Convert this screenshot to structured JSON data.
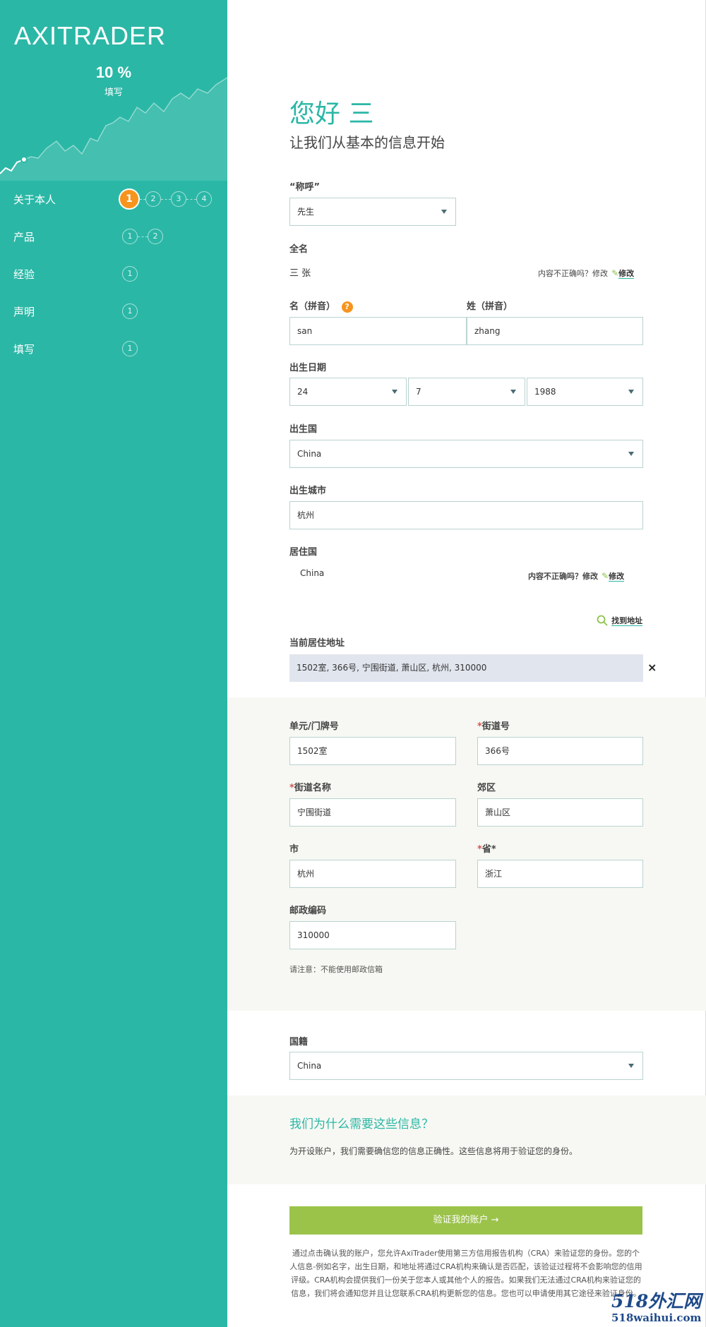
{
  "sidebar": {
    "logo": "AXITRADER",
    "progress_pct": "10 %",
    "progress_label": "填写",
    "nav": [
      {
        "label": "关于本人",
        "steps": [
          "1",
          "2",
          "3",
          "4"
        ],
        "active": 0
      },
      {
        "label": "产品",
        "steps": [
          "1",
          "2"
        ]
      },
      {
        "label": "经验",
        "steps": [
          "1"
        ]
      },
      {
        "label": "声明",
        "steps": [
          "1"
        ]
      },
      {
        "label": "填写",
        "steps": [
          "1"
        ]
      }
    ]
  },
  "header": {
    "greeting": "您好 三",
    "subtitle": "让我们从基本的信息开始"
  },
  "form": {
    "salutation_label": "“称呼”",
    "salutation_value": "先生",
    "fullname_label": "全名",
    "fullname_value": "三 张",
    "incorrect_q": "内容不正确吗？修改",
    "edit_link": "修改",
    "given_label": "名（拼音）",
    "help_icon_text": "?",
    "given_value": "san",
    "family_label": "姓（拼音）",
    "family_value": "zhang",
    "dob_label": "出生日期",
    "dob_day": "24",
    "dob_month": "7",
    "dob_year": "1988",
    "birth_country_label": "出生国",
    "birth_country_value": "China",
    "birth_city_label": "出生城市",
    "birth_city_value": "杭州",
    "residence_label": "居住国",
    "residence_value": "China",
    "find_address": "找到地址",
    "current_address_label": "当前居住地址",
    "current_address_value": "1502室, 366号, 宁围街道, 萧山区, 杭州, 310000",
    "clear_symbol": "×"
  },
  "address": {
    "unit_label": "单元/门牌号",
    "unit_value": "1502室",
    "street_no_label": "街道号",
    "street_no_value": "366号",
    "street_name_label": "街道名称",
    "street_name_value": "宁围街道",
    "suburb_label": "郊区",
    "suburb_value": "萧山区",
    "city_label": "市",
    "city_value": "杭州",
    "province_label": "省*",
    "province_value": "浙江",
    "postcode_label": "邮政编码",
    "postcode_value": "310000",
    "note": "请注意：不能使用邮政信箱",
    "required_mark": "*"
  },
  "nationality": {
    "label": "国籍",
    "value": "China"
  },
  "why": {
    "title": "我们为什么需要这些信息？",
    "text": "为开设账户，我们需要确信您的信息正确性。这些信息将用于验证您的身份。"
  },
  "verify_button": "验证我的账户 →",
  "disclaimer": "通过点击确认我的账户，您允许AxiTrader使用第三方信用报告机构（CRA）来验证您的身份。您的个人信息-例如名字，出生日期，和地址将通过CRA机构来确认是否匹配，该验证过程将不会影响您的信用评级。CRA机构会提供我们一份关于您本人或其他个人的报告。如果我们无法通过CRA机构来验证您的信息，我们将会通知您并且让您联系CRA机构更新您的信息。您也可以申请使用其它途径来验证身份。",
  "watermark": {
    "cn": "518外汇网",
    "en": "518waihui.com"
  },
  "colors": {
    "accent": "#2bb7a6",
    "orange": "#f7941d",
    "button": "#9bc34a"
  }
}
